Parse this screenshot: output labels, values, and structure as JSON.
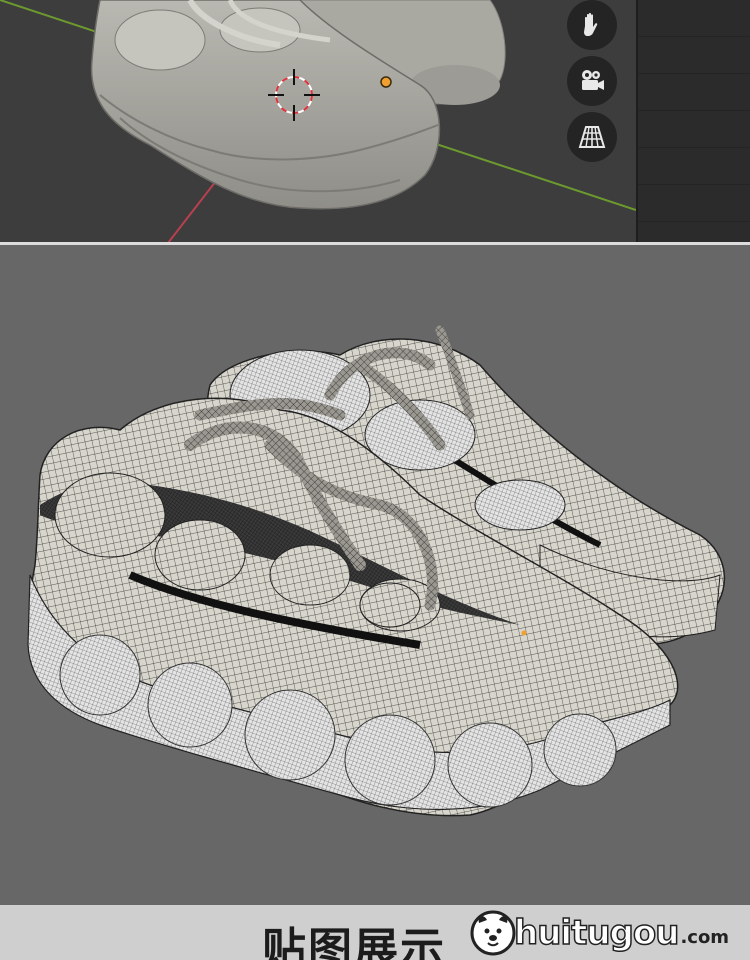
{
  "viewport_top": {
    "nav_buttons": [
      {
        "icon": "hand-pan-icon"
      },
      {
        "icon": "camera-icon"
      },
      {
        "icon": "perspective-grid-icon"
      }
    ],
    "colors": {
      "x_axis": "#b8404f",
      "y_axis": "#6c9a2e",
      "origin_dot": "#f0a030",
      "cursor_red": "#e0303a"
    }
  },
  "viewport_wire": {
    "background": "#676767",
    "mesh_color": "#222222",
    "surface_color": "#d8d6cc"
  },
  "footer": {
    "title": "贴图展示",
    "brand": "huitugou",
    "brand_suffix": ".com"
  }
}
